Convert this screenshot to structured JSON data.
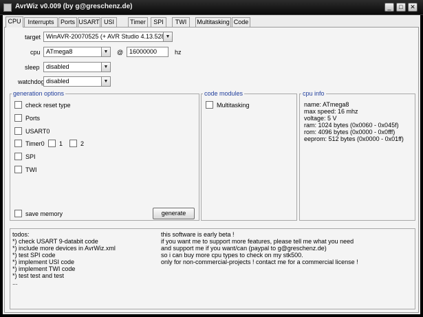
{
  "window": {
    "title": "AvrWiz v0.009 (by g@greschenz.de)",
    "controls": {
      "minimize": "_",
      "maximize": "□",
      "close": "✕"
    }
  },
  "tabs": [
    {
      "label": "CPU",
      "active": true
    },
    {
      "label": "Interrupts"
    },
    {
      "label": "Ports"
    },
    {
      "label": "USART"
    },
    {
      "label": "USI"
    },
    {
      "label": "Timer"
    },
    {
      "label": "SPI"
    },
    {
      "label": "TWI"
    },
    {
      "label": "Multitasking"
    },
    {
      "label": "Code"
    }
  ],
  "settings": {
    "target_label": "target",
    "target_value": "WinAVR-20070525 (+ AVR Studio 4.13.528)",
    "cpu_label": "cpu",
    "cpu_value": "ATmega8",
    "at_sign": "@",
    "freq_value": "16000000",
    "freq_unit": "hz",
    "sleep_label": "sleep",
    "sleep_value": "disabled",
    "watchdog_label": "watchdog",
    "watchdog_value": "disabled"
  },
  "generation_options": {
    "title": "generation options",
    "check_reset_type": "check reset type",
    "ports": "Ports",
    "usart0": "USART0",
    "timer0": "Timer0",
    "timer1": "1",
    "timer2": "2",
    "spi": "SPI",
    "twi": "TWI",
    "save_memory": "save memory",
    "generate_button": "generate"
  },
  "code_modules": {
    "title": "code modules",
    "multitasking": "Multitasking"
  },
  "cpu_info": {
    "title": "cpu info",
    "lines": [
      "name: ATmega8",
      "max speed: 16 mhz",
      "voltage: 5 V",
      "ram: 1024 bytes (0x0060 - 0x045f)",
      "rom: 4096 bytes (0x0000 - 0x0fff)",
      "eeprom: 512 bytes (0x0000 - 0x01ff)"
    ]
  },
  "notes": {
    "todos": [
      "todos:",
      "*) check USART 9-databit code",
      "*) include more devices in AvrWiz.xml",
      "*) test SPI code",
      "*) implement USI code",
      "*) implement TWI code",
      "*) test test and test",
      "..."
    ],
    "info": [
      "this software is early beta !",
      "if you want me to support more features, please tell me what you need",
      "and support me if you want/can (paypal to g@greschenz.de)",
      "so i can buy more cpu types to check on my stk500.",
      "only for non-commercial-projects ! contact me for a commercial license !"
    ]
  }
}
